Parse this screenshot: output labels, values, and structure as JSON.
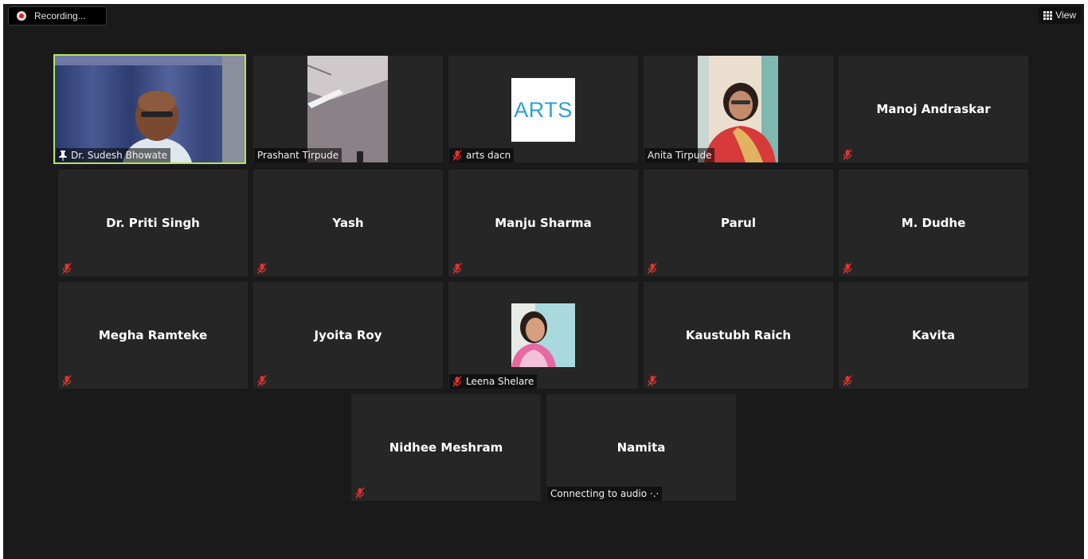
{
  "toolbar": {
    "recording_label": "Recording...",
    "view_label": "View"
  },
  "colors": {
    "background": "#1a1a1a",
    "tile": "#262626",
    "active_speaker_border": "#b5e35f",
    "mute_icon": "#e0332e",
    "arts_text": "#2aa0d8"
  },
  "participants": [
    {
      "name": "Dr. Sudesh Bhowate",
      "video": true,
      "pinned": true,
      "active_speaker": true
    },
    {
      "name": "Prashant Tirpude",
      "video": true
    },
    {
      "name": "arts dacn",
      "video": true,
      "muted": true,
      "profile_text": "ARTS"
    },
    {
      "name": "Anita Tirpude",
      "video": true
    },
    {
      "name": "Manoj Andraskar",
      "muted": true
    },
    {
      "name": "Dr. Priti Singh",
      "muted": true
    },
    {
      "name": "Yash",
      "muted": true
    },
    {
      "name": "Manju Sharma",
      "muted": true
    },
    {
      "name": "Parul",
      "muted": true
    },
    {
      "name": "M. Dudhe",
      "muted": true
    },
    {
      "name": "Megha Ramteke",
      "muted": true
    },
    {
      "name": "Jyoita Roy",
      "muted": true
    },
    {
      "name": "Leena Shelare",
      "video": true,
      "muted": true
    },
    {
      "name": "Kaustubh Raich",
      "muted": true
    },
    {
      "name": "Kavita",
      "muted": true
    },
    {
      "name": "Nidhee Meshram",
      "muted": true
    },
    {
      "name": "Namita",
      "status": "Connecting to audio ·.·"
    }
  ]
}
